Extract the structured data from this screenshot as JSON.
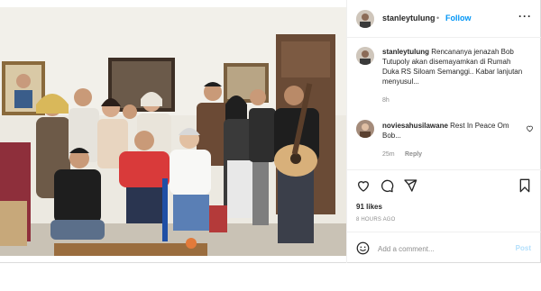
{
  "post": {
    "username": "stanleytulung",
    "separator": "•",
    "follow_label": "Follow",
    "more_label": "···"
  },
  "caption": {
    "username": "stanleytulung",
    "text": "Rencananya jenazah Bob Tutupoly akan disemayamkan di Rumah Duka RS Siloam Semanggi.. Kabar lanjutan menyusul...",
    "time": "8h"
  },
  "comments": [
    {
      "username": "noviesahusilawane",
      "text": "Rest In Peace Om Bob...",
      "time": "25m",
      "reply_label": "Reply"
    }
  ],
  "actions": {
    "likes": "91 likes",
    "date": "8 HOURS AGO"
  },
  "comment_box": {
    "placeholder": "Add a comment...",
    "post_label": "Post"
  },
  "colors": {
    "accent": "#0095f6",
    "post_disabled": "#b2dffc",
    "text": "#262626",
    "muted": "#8e8e8e"
  }
}
